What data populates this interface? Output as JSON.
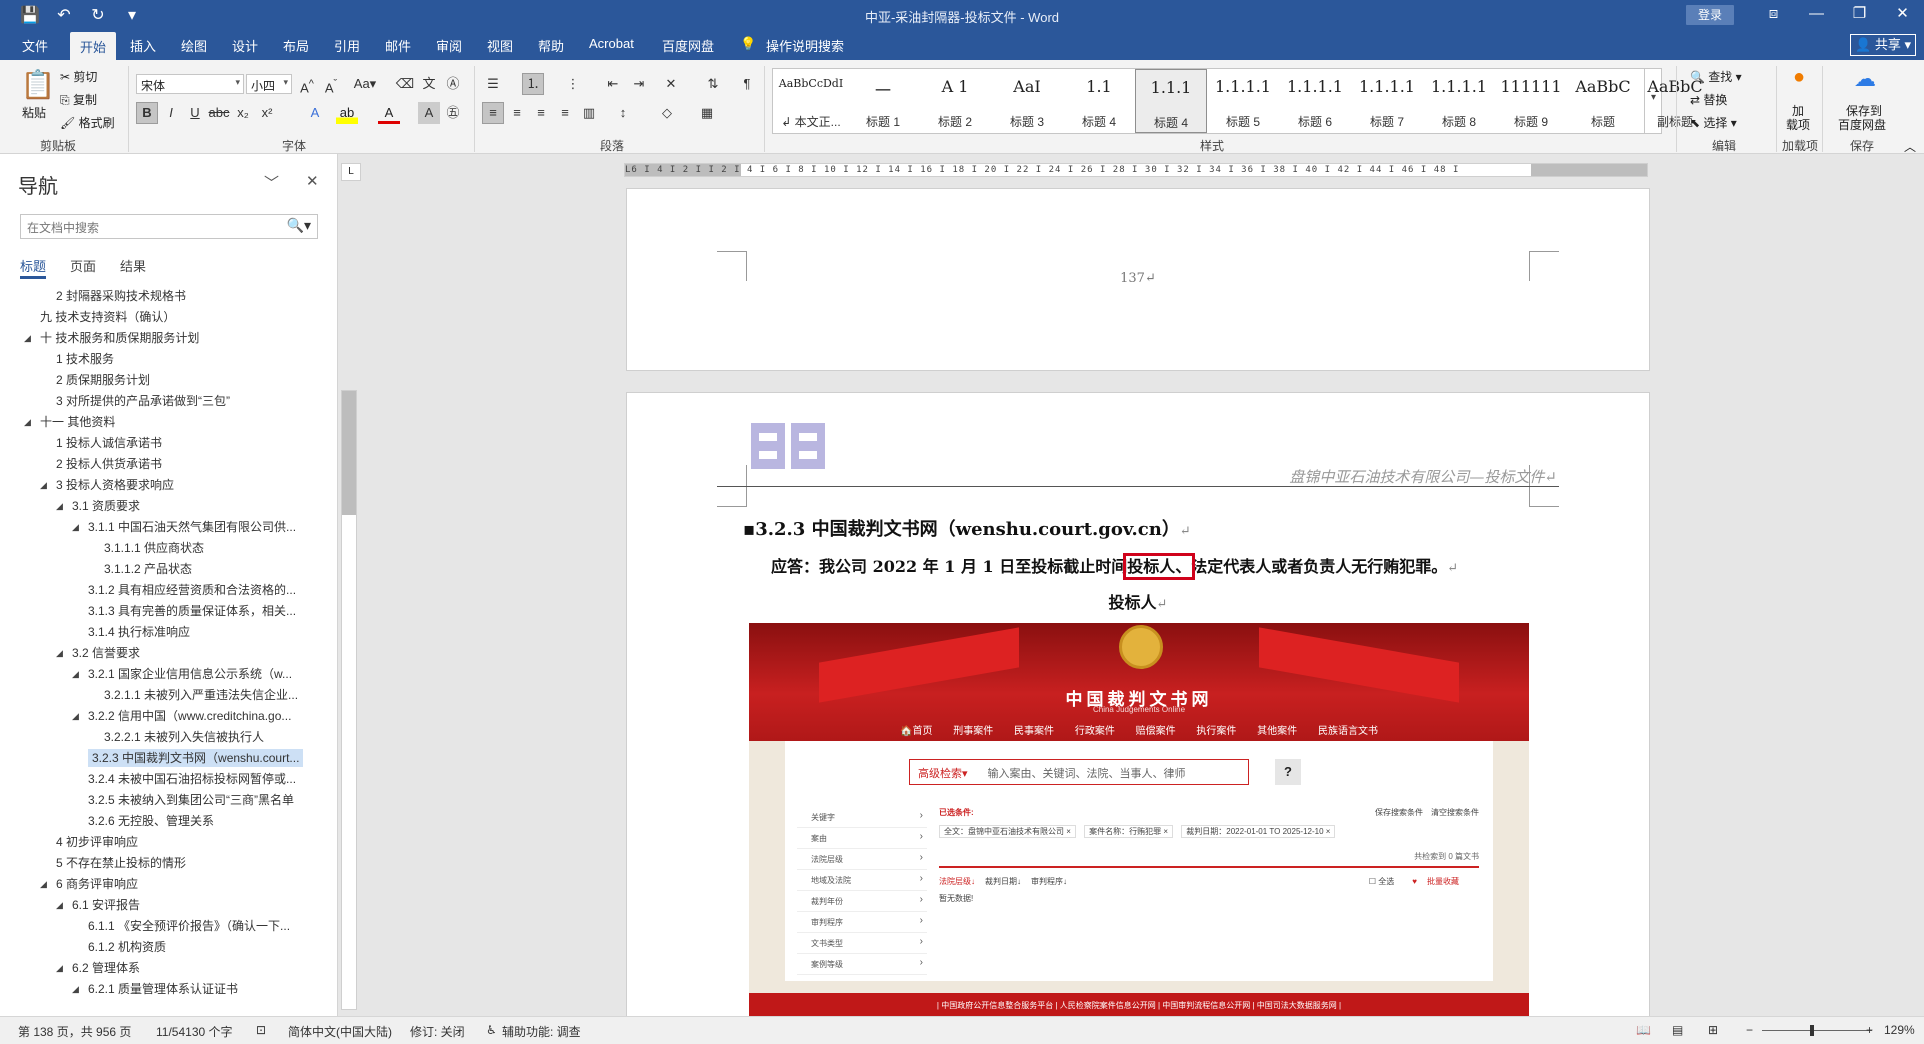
{
  "window": {
    "title": "中亚-采油封隔器-投标文件  -  Word",
    "login": "登录",
    "qat": [
      "💾",
      "↶",
      "↻",
      "▾"
    ],
    "controls": [
      "⧈",
      "—",
      "❐",
      "✕"
    ]
  },
  "tabs": {
    "items": [
      "文件",
      "开始",
      "插入",
      "绘图",
      "设计",
      "布局",
      "引用",
      "邮件",
      "审阅",
      "视图",
      "帮助",
      "Acrobat",
      "百度网盘",
      "操作说明搜索"
    ],
    "active": "开始",
    "share": "共享"
  },
  "ribbon": {
    "clipboard": {
      "paste": "粘贴",
      "cut": "剪切",
      "copy": "复制",
      "format_painter": "格式刷",
      "label": "剪贴板"
    },
    "font": {
      "name": "宋体",
      "size": "小四",
      "label": "字体"
    },
    "paragraph": {
      "label": "段落"
    },
    "styles": {
      "label": "样式",
      "items": [
        {
          "sample": "AaBbCcDdI",
          "name": "↲ 本文正..."
        },
        {
          "sample": "一",
          "name": "标题 1"
        },
        {
          "sample": "A 1",
          "name": "标题 2"
        },
        {
          "sample": "AaI",
          "name": "标题 3"
        },
        {
          "sample": "1.1",
          "name": "标题 4"
        },
        {
          "sample": "1.1.1",
          "name": "标题 4"
        },
        {
          "sample": "1.1.1.1",
          "name": "标题 5"
        },
        {
          "sample": "1.1.1.1",
          "name": "标题 6"
        },
        {
          "sample": "1.1.1.1",
          "name": "标题 7"
        },
        {
          "sample": "1.1.1.1",
          "name": "标题 8"
        },
        {
          "sample": "111111",
          "name": "标题 9"
        },
        {
          "sample": "AaBbC",
          "name": "标题"
        },
        {
          "sample": "AaBbC",
          "name": "副标题"
        }
      ],
      "selected_index": 5
    },
    "editing": {
      "find": "查找",
      "replace": "替换",
      "select": "选择",
      "label": "编辑"
    },
    "addins": {
      "load": "加载项",
      "label": "加载项",
      "load_line1": "加",
      "load_line2": "载项"
    },
    "save": {
      "btn_line1": "保存到",
      "btn_line2": "百度网盘",
      "label": "保存"
    }
  },
  "navpane": {
    "title": "导航",
    "search_placeholder": "在文档中搜索",
    "tabs": [
      "标题",
      "页面",
      "结果"
    ],
    "items": [
      {
        "level": 2,
        "text": "2 封隔器采购技术规格书",
        "tri": false
      },
      {
        "level": 1,
        "text": "九 技术支持资料（确认）",
        "tri": false
      },
      {
        "level": 1,
        "text": "十 技术服务和质保期服务计划",
        "tri": true
      },
      {
        "level": 2,
        "text": "1 技术服务",
        "tri": false
      },
      {
        "level": 2,
        "text": "2 质保期服务计划",
        "tri": false
      },
      {
        "level": 2,
        "text": "3 对所提供的产品承诺做到“三包”",
        "tri": false
      },
      {
        "level": 1,
        "text": "十一 其他资料",
        "tri": true
      },
      {
        "level": 2,
        "text": "1 投标人诚信承诺书",
        "tri": false
      },
      {
        "level": 2,
        "text": "2 投标人供货承诺书",
        "tri": false
      },
      {
        "level": 2,
        "text": "3 投标人资格要求响应",
        "tri": true
      },
      {
        "level": 3,
        "text": "3.1 资质要求",
        "tri": true
      },
      {
        "level": 4,
        "text": "3.1.1 中国石油天然气集团有限公司供...",
        "tri": true
      },
      {
        "level": 5,
        "text": "3.1.1.1 供应商状态",
        "tri": false
      },
      {
        "level": 5,
        "text": "3.1.1.2 产品状态",
        "tri": false
      },
      {
        "level": 4,
        "text": "3.1.2 具有相应经营资质和合法资格的...",
        "tri": false
      },
      {
        "level": 4,
        "text": "3.1.3 具有完善的质量保证体系，相关...",
        "tri": false
      },
      {
        "level": 4,
        "text": "3.1.4 执行标准响应",
        "tri": false
      },
      {
        "level": 3,
        "text": "3.2 信誉要求",
        "tri": true
      },
      {
        "level": 4,
        "text": "3.2.1 国家企业信用信息公示系统（w...",
        "tri": true
      },
      {
        "level": 5,
        "text": "3.2.1.1 未被列入严重违法失信企业...",
        "tri": false
      },
      {
        "level": 4,
        "text": "3.2.2 信用中国（www.creditchina.go...",
        "tri": true
      },
      {
        "level": 5,
        "text": "3.2.2.1 未被列入失信被执行人",
        "tri": false
      },
      {
        "level": 4,
        "text": "3.2.3 中国裁判文书网（wenshu.court...",
        "tri": false,
        "selected": true
      },
      {
        "level": 4,
        "text": "3.2.4 未被中国石油招标投标网暂停或...",
        "tri": false
      },
      {
        "level": 4,
        "text": "3.2.5 未被纳入到集团公司“三商”黑名单",
        "tri": false
      },
      {
        "level": 4,
        "text": "3.2.6 无控股、管理关系",
        "tri": false
      },
      {
        "level": 2,
        "text": "4 初步评审响应",
        "tri": false
      },
      {
        "level": 2,
        "text": "5 不存在禁止投标的情形",
        "tri": false
      },
      {
        "level": 2,
        "text": "6 商务评审响应",
        "tri": true
      },
      {
        "level": 3,
        "text": "6.1 安评报告",
        "tri": true
      },
      {
        "level": 4,
        "text": "6.1.1 《安全预评价报告》（确认一下...",
        "tri": false
      },
      {
        "level": 4,
        "text": "6.1.2 机构资质",
        "tri": false
      },
      {
        "level": 3,
        "text": "6.2 管理体系",
        "tri": true
      },
      {
        "level": 4,
        "text": "6.2.1 质量管理体系认证证书",
        "tri": true
      }
    ]
  },
  "document": {
    "ruler_ticks": "L6 I 4 I 2 I   I 2 I 4 I 6 I 8 I 10 I 12 I 14 I 16 I 18 I 20 I 22 I 24 I 26 I 28 I 30 I 32 I 34 I 36 I 38 I 40 I 42 I 44 I 46 I 48 I",
    "page_number": "137↵",
    "header_text": "盘锦中亚石油技术有限公司—投标文件↵",
    "heading": "3.2.3 中国裁判文书网（wenshu.court.gov.cn）",
    "answer_prefix": "应答：我公司 2022 年 1 月 1 日至投标截止时间",
    "answer_highlight": "投标人、",
    "answer_suffix": "法定代表人或者负责人无行贿犯罪。",
    "caption": "投标人",
    "para_mark": "↵"
  },
  "website": {
    "title": "中国裁判文书网",
    "subtitle": "China Judgements Online",
    "menu": [
      "🏠首页",
      "刑事案件",
      "民事案件",
      "行政案件",
      "赔偿案件",
      "执行案件",
      "其他案件",
      "民族语言文书"
    ],
    "search_type": "高级检索▾",
    "search_placeholder": "输入案由、关键词、法院、当事人、律师",
    "help": "?",
    "facets": [
      "关键字",
      "案由",
      "法院层级",
      "地域及法院",
      "裁判年份",
      "审判程序",
      "文书类型",
      "案例等级"
    ],
    "selected_label": "已选条件:",
    "save_cond": "保存搜索条件",
    "clear_cond": "清空搜索条件",
    "conditions": [
      "全文：盘锦中亚石油技术有限公司 ×",
      "案件名称：行贿犯罪 ×",
      "裁判日期：2022-01-01 TO 2025-12-10 ×"
    ],
    "count": "共检索到 0 篇文书",
    "sorts": [
      "法院层级↓",
      "裁判日期↓",
      "审判程序↓"
    ],
    "select_all": "全选",
    "batch_save": "批量收藏",
    "empty": "暂无数据!",
    "links": "| 中国政府公开信息整合服务平台 | 人民检察院案件信息公开网 | 中国审判流程信息公开网 | 中国司法大数据服务网 |"
  },
  "statusbar": {
    "page": "第 138 页，共 956 页",
    "words": "11/54130 个字",
    "lang": "简体中文(中国大陆)",
    "track": "修订: 关闭",
    "access": "辅助功能: 调查",
    "zoom": "129%"
  }
}
